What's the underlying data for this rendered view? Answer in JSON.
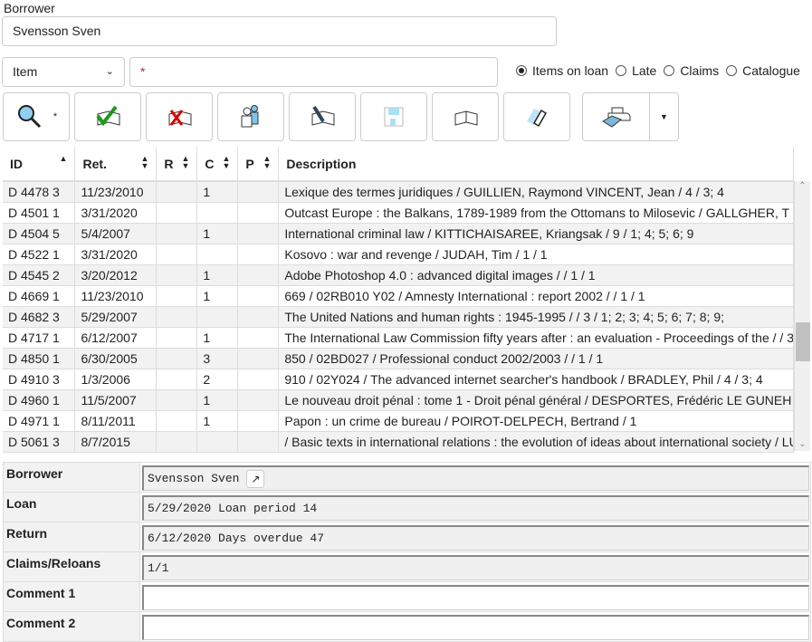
{
  "borrower": {
    "label": "Borrower",
    "value": "Svensson Sven"
  },
  "search": {
    "type_selected": "Item",
    "query": "*",
    "radios": [
      {
        "label": "Items on loan",
        "checked": true
      },
      {
        "label": "Late",
        "checked": false
      },
      {
        "label": "Claims",
        "checked": false
      },
      {
        "label": "Catalogue",
        "checked": false
      }
    ]
  },
  "toolbar": {
    "search_suffix": "*",
    "buttons": [
      "search-icon",
      "checkout-icon",
      "checkin-cancel-icon",
      "users-icon",
      "edit-book-icon",
      "save-icon",
      "book-icon",
      "eraser-icon",
      "printer-icon"
    ]
  },
  "table": {
    "columns": [
      "ID",
      "Ret.",
      "R",
      "C",
      "P",
      "Description"
    ],
    "rows": [
      [
        "D 4478 3",
        "11/23/2010",
        "",
        "1",
        "",
        "Lexique des termes juridiques / GUILLIEN, Raymond VINCENT, Jean / 4 / 3; 4"
      ],
      [
        "D 4501 1",
        "3/31/2020",
        "",
        "",
        "",
        "Outcast Europe : the Balkans, 1789-1989 from the Ottomans to Milosevic / GALLGHER, T"
      ],
      [
        "D 4504 5",
        "5/4/2007",
        "",
        "1",
        "",
        "International criminal law / KITTICHAISAREE, Kriangsak / 9 / 1; 4; 5; 6; 9"
      ],
      [
        "D 4522 1",
        "3/31/2020",
        "",
        "",
        "",
        "Kosovo : war and revenge / JUDAH, Tim / 1 / 1"
      ],
      [
        "D 4545 2",
        "3/20/2012",
        "",
        "1",
        "",
        "Adobe Photoshop 4.0 : advanced digital images / / 1 / 1"
      ],
      [
        "D 4669 1",
        "11/23/2010",
        "",
        "1",
        "",
        "669 / 02RB010 Y02 / Amnesty International : report 2002 / / 1 / 1"
      ],
      [
        "D 4682 3",
        "5/29/2007",
        "",
        "",
        "",
        "The United Nations and human rights : 1945-1995 / / 3 / 1; 2; 3; 4; 5; 6; 7; 8; 9;"
      ],
      [
        "D 4717 1",
        "6/12/2007",
        "",
        "1",
        "",
        "The International Law Commission fifty years after : an evaluation - Proceedings of the / / 3"
      ],
      [
        "D 4850 1",
        "6/30/2005",
        "",
        "3",
        "",
        "850 / 02BD027 / Professional conduct 2002/2003 / / 1 / 1"
      ],
      [
        "D 4910 3",
        "1/3/2006",
        "",
        "2",
        "",
        "910 / 02Y024 / The advanced internet searcher's handbook / BRADLEY, Phil / 4 / 3; 4"
      ],
      [
        "D 4960 1",
        "11/5/2007",
        "",
        "1",
        "",
        "Le nouveau droit pénal : tome 1 - Droit pénal général / DESPORTES, Frédéric LE GUNEH"
      ],
      [
        "D 4971 1",
        "8/11/2011",
        "",
        "1",
        "",
        "Papon : un crime de bureau / POIROT-DELPECH, Bertrand / 1"
      ],
      [
        "D 5061 3",
        "8/7/2015",
        "",
        "",
        "",
        "/ Basic texts in international relations : the evolution of ideas about international society / LU"
      ]
    ]
  },
  "details": [
    {
      "label": "Borrower",
      "value": "Svensson Sven"
    },
    {
      "label": "Loan",
      "value": "5/29/2020 Loan period 14"
    },
    {
      "label": "Return",
      "value": "6/12/2020 Days overdue 47"
    },
    {
      "label": "Claims/Reloans",
      "value": "1/1"
    },
    {
      "label": "Comment 1",
      "value": ""
    },
    {
      "label": "Comment 2",
      "value": ""
    }
  ]
}
